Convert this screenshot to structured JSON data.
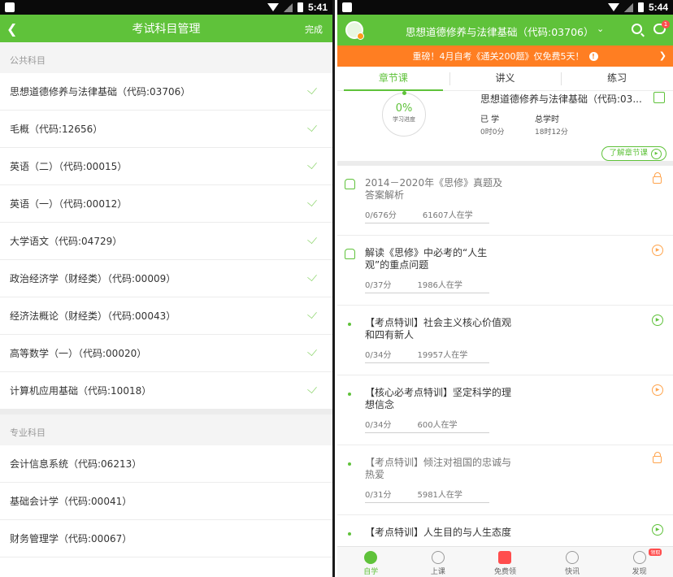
{
  "left": {
    "status_time": "5:41",
    "title": "考试科目管理",
    "done_label": "完成",
    "public_section": "公共科目",
    "public_subjects": [
      {
        "name": "思想道德修养与法律基础（代码:03706）"
      },
      {
        "name": "毛概（代码:12656）"
      },
      {
        "name": "英语（二）（代码:00015）"
      },
      {
        "name": "英语（一）（代码:00012）"
      },
      {
        "name": "大学语文（代码:04729）"
      },
      {
        "name": "政治经济学（财经类）（代码:00009）"
      },
      {
        "name": "经济法概论（财经类）（代码:00043）"
      },
      {
        "name": "高等数学（一）（代码:00020）"
      },
      {
        "name": "计算机应用基础（代码:10018）"
      }
    ],
    "major_section": "专业科目",
    "major_subjects": [
      {
        "name": "会计信息系统（代码:06213）"
      },
      {
        "name": "基础会计学（代码:00041）"
      },
      {
        "name": "财务管理学（代码:00067）"
      }
    ]
  },
  "right": {
    "status_time": "5:44",
    "header_title": "思想道德修养与法律基础（代码:03706）",
    "badge": "1",
    "banner": "重磅！4月自考《通关200题》仅免费5天！",
    "tabs": [
      "章节课",
      "讲义",
      "练习"
    ],
    "progress_percent": "0%",
    "progress_label": "学习进度",
    "course_title": "思想道德修养与法律基础（代码:03...",
    "learned_label": "已 学",
    "learned_value": "0时0分",
    "total_label": "总学时",
    "total_value": "18时12分",
    "learn_link": "了解章节课",
    "lessons": [
      {
        "title": "2014－2020年《思修》真题及答案解析",
        "score": "0/676分",
        "learners": "61607人在学",
        "lead": "home",
        "status": "lock"
      },
      {
        "title": "解读《思修》中必考的“人生观”的重点问题",
        "score": "0/37分",
        "learners": "1986人在学",
        "lead": "home",
        "status": "play-orange"
      },
      {
        "title": "【考点特训】社会主义核心价值观和四有新人",
        "score": "0/34分",
        "learners": "19957人在学",
        "lead": "dot",
        "status": "play-green"
      },
      {
        "title": "【核心必考点特训】坚定科学的理想信念",
        "score": "0/34分",
        "learners": "600人在学",
        "lead": "dot",
        "status": "play-orange"
      },
      {
        "title": "【考点特训】倾注对祖国的忠诚与热爱",
        "score": "0/31分",
        "learners": "5981人在学",
        "lead": "dot",
        "status": "lock"
      },
      {
        "title": "【考点特训】人生目的与人生态度",
        "score": "",
        "learners": "",
        "lead": "dot",
        "status": "play-green"
      }
    ],
    "nav": [
      {
        "label": "自学"
      },
      {
        "label": "上课"
      },
      {
        "label": "免费领"
      },
      {
        "label": "快讯"
      },
      {
        "label": "发现"
      }
    ],
    "hot_badge": "领取"
  }
}
